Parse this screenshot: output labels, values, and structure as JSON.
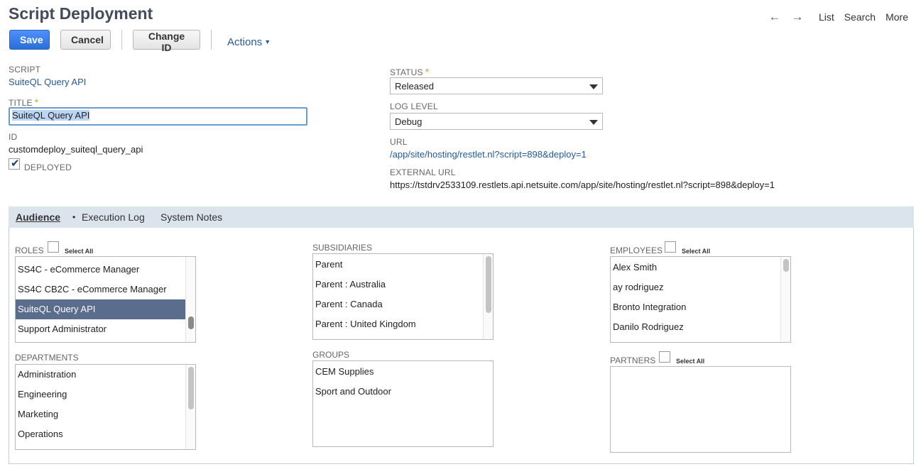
{
  "page": {
    "title": "Script Deployment"
  },
  "topnav": {
    "back_icon": "←",
    "forward_icon": "→",
    "list": "List",
    "search": "Search",
    "more": "More"
  },
  "toolbar": {
    "save": "Save",
    "cancel": "Cancel",
    "change_id": "Change ID",
    "actions": "Actions"
  },
  "fields": {
    "script_label": "SCRIPT",
    "script_value": "SuiteQL Query API",
    "title_label": "TITLE",
    "title_value": "SuiteQL Query API",
    "id_label": "ID",
    "id_value": "customdeploy_suiteql_query_api",
    "deployed_label": "DEPLOYED",
    "deployed_checked": true,
    "status_label": "STATUS",
    "status_value": "Released",
    "log_level_label": "LOG LEVEL",
    "log_level_value": "Debug",
    "url_label": "URL",
    "url_value": "/app/site/hosting/restlet.nl?script=898&deploy=1",
    "external_url_label": "EXTERNAL URL",
    "external_url_value": "https://tstdrv2533109.restlets.api.netsuite.com/app/site/hosting/restlet.nl?script=898&deploy=1"
  },
  "tabs": [
    {
      "label": "Audience",
      "active": true
    },
    {
      "label": "Execution Log",
      "active": false
    },
    {
      "label": "System Notes",
      "active": false
    }
  ],
  "audience": {
    "select_all": "Select All",
    "roles": {
      "label": "ROLES",
      "items": [
        "SS4C - eCommerce Manager",
        "SS4C CB2C - eCommerce Manager",
        "SuiteQL Query API",
        "Support Administrator"
      ],
      "selected_index": 2
    },
    "departments": {
      "label": "DEPARTMENTS",
      "items": [
        "Administration",
        "Engineering",
        "Marketing",
        "Operations"
      ]
    },
    "subsidiaries": {
      "label": "SUBSIDIARIES",
      "items": [
        "Parent",
        "Parent : Australia",
        "Parent : Canada",
        "Parent : United Kingdom"
      ]
    },
    "groups": {
      "label": "GROUPS",
      "items": [
        "CEM Supplies",
        "Sport and Outdoor"
      ]
    },
    "employees": {
      "label": "EMPLOYEES",
      "items": [
        "Alex Smith",
        "ay rodriguez",
        "Bronto Integration",
        "Danilo Rodriguez"
      ]
    },
    "partners": {
      "label": "PARTNERS",
      "items": []
    }
  },
  "colors": {
    "accent": "#245a9b",
    "primary_button": "#2a6fd6",
    "selected_row": "#5a6d8c",
    "tab_bar": "#dbe3ed",
    "required": "#e3a317"
  }
}
